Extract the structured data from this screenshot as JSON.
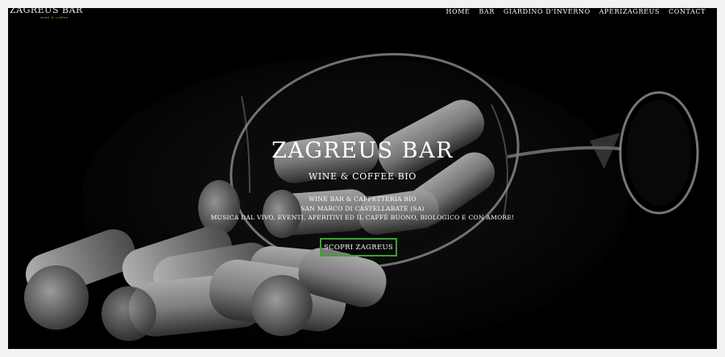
{
  "site": {
    "logo_text": "ZAGREUS BAR",
    "logo_tagline": "wine & coffee",
    "accent_color": "#3ea22f"
  },
  "nav": {
    "items": [
      {
        "label": "HOME"
      },
      {
        "label": "BAR"
      },
      {
        "label": "GIARDINO D'INVERNO"
      },
      {
        "label": "APERIZAGREUS"
      },
      {
        "label": "CONTACT"
      }
    ]
  },
  "hero": {
    "title": "ZAGREUS BAR",
    "subtitle": "WINE & COFFEE BIO",
    "lines": [
      "WINE BAR & CAFFETTERIA BIO",
      "SAN MARCO DI CASTELLABATE (SA)",
      "MUSICA DAL VIVO, EVENTI, APERITIVI ED IL CAFFÈ BUONO, BIOLOGICO E CON AMORE!"
    ],
    "cta_label": "SCOPRI ZAGREUS",
    "background_image": "wine-glass-with-corks-photo"
  }
}
